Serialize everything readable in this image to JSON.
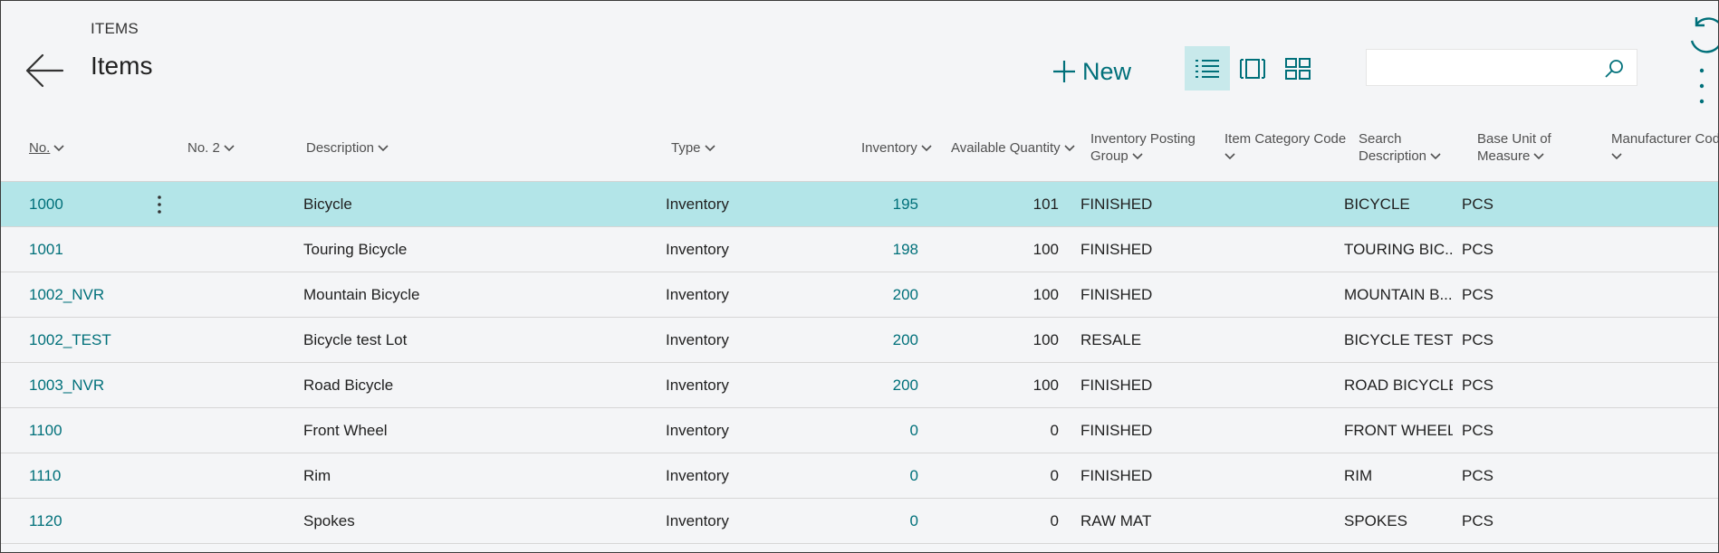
{
  "breadcrumb": "ITEMS",
  "title": "Items",
  "toolbar": {
    "new_label": "New",
    "views": [
      "list-view-icon",
      "tile-view-icon",
      "brick-view-icon"
    ],
    "active_view": "list-view-icon"
  },
  "search": {
    "placeholder": "",
    "value": ""
  },
  "colors": {
    "accent": "#00707a",
    "selected_row": "#b3e5e8",
    "active_view": "#c8e9eb"
  },
  "columns": {
    "no": "No.",
    "no2": "No. 2",
    "description": "Description",
    "type": "Type",
    "inventory": "Inventory",
    "available_quantity": "Available Quantity",
    "inventory_posting_group_1": "Inventory Posting",
    "inventory_posting_group_2": "Group",
    "item_category_code": "Item Category Code",
    "search_description_1": "Search",
    "search_description_2": "Description",
    "base_unit_1": "Base Unit of",
    "base_unit_2": "Measure",
    "manufacturer_code": "Manufacturer Cod"
  },
  "rows": [
    {
      "no": "1000",
      "description": "Bicycle",
      "type": "Inventory",
      "inventory": "195",
      "available": "101",
      "posting_group": "FINISHED",
      "search_description": "BICYCLE",
      "base_unit": "PCS"
    },
    {
      "no": "1001",
      "description": "Touring Bicycle",
      "type": "Inventory",
      "inventory": "198",
      "available": "100",
      "posting_group": "FINISHED",
      "search_description": "TOURING BIC...",
      "base_unit": "PCS"
    },
    {
      "no": "1002_NVR",
      "description": "Mountain Bicycle",
      "type": "Inventory",
      "inventory": "200",
      "available": "100",
      "posting_group": "FINISHED",
      "search_description": "MOUNTAIN B...",
      "base_unit": "PCS"
    },
    {
      "no": "1002_TEST",
      "description": "Bicycle test Lot",
      "type": "Inventory",
      "inventory": "200",
      "available": "100",
      "posting_group": "RESALE",
      "search_description": "BICYCLE TEST ...",
      "base_unit": "PCS"
    },
    {
      "no": "1003_NVR",
      "description": "Road Bicycle",
      "type": "Inventory",
      "inventory": "200",
      "available": "100",
      "posting_group": "FINISHED",
      "search_description": "ROAD BICYCLE",
      "base_unit": "PCS"
    },
    {
      "no": "1100",
      "description": "Front Wheel",
      "type": "Inventory",
      "inventory": "0",
      "available": "0",
      "posting_group": "FINISHED",
      "search_description": "FRONT WHEEL",
      "base_unit": "PCS"
    },
    {
      "no": "1110",
      "description": "Rim",
      "type": "Inventory",
      "inventory": "0",
      "available": "0",
      "posting_group": "FINISHED",
      "search_description": "RIM",
      "base_unit": "PCS"
    },
    {
      "no": "1120",
      "description": "Spokes",
      "type": "Inventory",
      "inventory": "0",
      "available": "0",
      "posting_group": "RAW MAT",
      "search_description": "SPOKES",
      "base_unit": "PCS"
    }
  ],
  "selected_row": 0
}
